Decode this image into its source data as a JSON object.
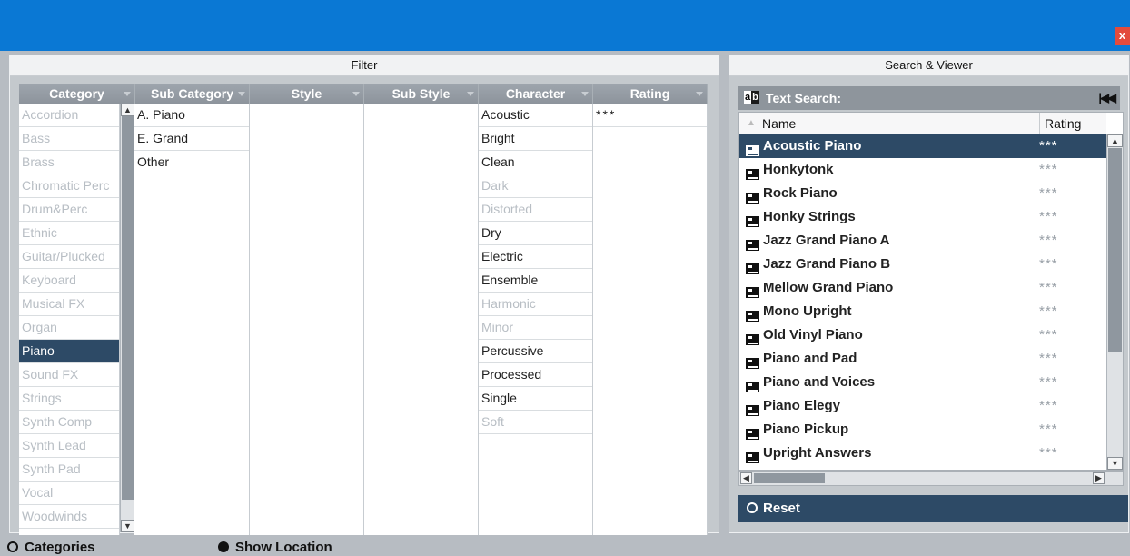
{
  "window": {
    "close_label": "x"
  },
  "filter": {
    "title": "Filter",
    "columns": {
      "category": "Category",
      "subcategory": "Sub Category",
      "style": "Style",
      "substyle": "Sub Style",
      "character": "Character",
      "rating": "Rating"
    },
    "categories": [
      "Accordion",
      "Bass",
      "Brass",
      "Chromatic Perc",
      "Drum&Perc",
      "Ethnic",
      "Guitar/Plucked",
      "Keyboard",
      "Musical FX",
      "Organ",
      "Piano",
      "Sound FX",
      "Strings",
      "Synth Comp",
      "Synth Lead",
      "Synth Pad",
      "Vocal",
      "Woodwinds"
    ],
    "selected_category": "Piano",
    "subcategories": [
      "A. Piano",
      "E. Grand",
      "Other"
    ],
    "characters": [
      {
        "label": "Acoustic",
        "active": true
      },
      {
        "label": "Bright",
        "active": true
      },
      {
        "label": "Clean",
        "active": true
      },
      {
        "label": "Dark",
        "active": false
      },
      {
        "label": "Distorted",
        "active": false
      },
      {
        "label": "Dry",
        "active": true
      },
      {
        "label": "Electric",
        "active": true
      },
      {
        "label": "Ensemble",
        "active": true
      },
      {
        "label": "Harmonic",
        "active": false
      },
      {
        "label": "Minor",
        "active": false
      },
      {
        "label": "Percussive",
        "active": true
      },
      {
        "label": "Processed",
        "active": true
      },
      {
        "label": "Single",
        "active": true
      },
      {
        "label": "Soft",
        "active": false
      }
    ],
    "ratings": [
      "***"
    ]
  },
  "viewer": {
    "title": "Search & Viewer",
    "search_label": "Text Search:",
    "search_icon": "ab-text-icon",
    "rewind_icon": "⏮",
    "columns": {
      "name": "Name",
      "rating": "Rating",
      "sort_indicator": "▲"
    },
    "results": [
      {
        "name": "Acoustic Piano",
        "rating": "***",
        "selected": true
      },
      {
        "name": "Honkytonk",
        "rating": "***"
      },
      {
        "name": "Rock Piano",
        "rating": "***"
      },
      {
        "name": "Honky Strings",
        "rating": "***"
      },
      {
        "name": "Jazz Grand Piano A",
        "rating": "***"
      },
      {
        "name": "Jazz Grand Piano B",
        "rating": "***"
      },
      {
        "name": "Mellow Grand Piano",
        "rating": "***"
      },
      {
        "name": "Mono Upright",
        "rating": "***"
      },
      {
        "name": "Old Vinyl Piano",
        "rating": "***"
      },
      {
        "name": "Piano and Pad",
        "rating": "***"
      },
      {
        "name": "Piano and Voices",
        "rating": "***"
      },
      {
        "name": "Piano Elegy",
        "rating": "***"
      },
      {
        "name": "Piano Pickup",
        "rating": "***"
      },
      {
        "name": "Upright Answers",
        "rating": "***"
      }
    ],
    "reset_label": "Reset"
  },
  "footer": {
    "categories_label": "Categories",
    "show_location_label": "Show Location"
  },
  "colors": {
    "titlebar": "#0a78d4",
    "selection": "#2d4a66",
    "header": "#8e959c",
    "close": "#e34b3c"
  }
}
